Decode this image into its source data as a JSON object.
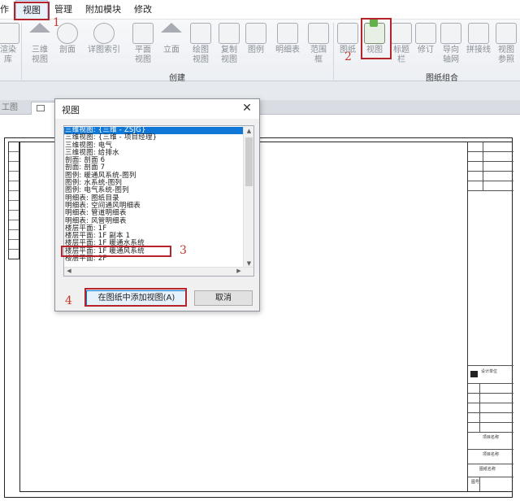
{
  "menubar": {
    "items": [
      "作",
      "视图",
      "管理",
      "附加模块",
      "修改"
    ],
    "active_index": 1
  },
  "ribbon": {
    "buttons": [
      {
        "id": "render-lib",
        "label": "渲染\n库"
      },
      {
        "id": "3d-view",
        "label": "三维\n视图"
      },
      {
        "id": "section",
        "label": "剖面"
      },
      {
        "id": "callout",
        "label": "详图索引"
      },
      {
        "id": "plan-view",
        "label": "平面\n视图"
      },
      {
        "id": "elevation",
        "label": "立面"
      },
      {
        "id": "drafting-view",
        "label": "绘图\n视图"
      },
      {
        "id": "duplicate-view",
        "label": "复制\n视图"
      },
      {
        "id": "legend",
        "label": "图例"
      },
      {
        "id": "schedule",
        "label": "明细表"
      },
      {
        "id": "scope-box",
        "label": "范围\n框"
      },
      {
        "id": "sheet",
        "label": "图纸"
      },
      {
        "id": "view",
        "label": "视图"
      },
      {
        "id": "title-block",
        "label": "标题\n栏"
      },
      {
        "id": "revision",
        "label": "修订"
      },
      {
        "id": "guide-grid",
        "label": "导向\n轴网"
      },
      {
        "id": "matchline",
        "label": "拼接线"
      },
      {
        "id": "view-ref",
        "label": "视图\n参照"
      }
    ],
    "group_create": "创建",
    "group_sheet": "图纸组合",
    "accent_green": "#62b14b"
  },
  "tabs": {
    "left_tab": "工图"
  },
  "dialog": {
    "title": "视图",
    "close_glyph": "✕",
    "list": [
      "三维视图: {三维 - ZSJG}",
      "三维视图: {三维 - 项目经理}",
      "三维视图: 电气",
      "三维视图: 给排水",
      "剖面: 剖面 6",
      "剖面: 剖面 7",
      "图例: 暖通风系统-图列",
      "图例: 水系统-图列",
      "图例: 电气系统-图列",
      "明细表: 图纸目录",
      "明细表: 空间通风明细表",
      "明细表: 管道明细表",
      "明细表: 风管明细表",
      "楼层平面: 1F",
      "楼层平面: 1F 副本 1",
      "楼层平面: 1F 暖通水系统",
      "楼层平面: 1F 暖通风系统",
      "楼层平面: 2F"
    ],
    "selected_index": 0,
    "add_button": "在图纸中添加视图(A)",
    "cancel_button": "取消"
  },
  "annotations": {
    "step1": "1",
    "step2": "2",
    "step3": "3",
    "step4": "4",
    "color": "#b5242a"
  },
  "title_block": {
    "cells": [
      "设计单位",
      "项目名称",
      "项目名称",
      "图纸名称",
      "图号"
    ]
  }
}
